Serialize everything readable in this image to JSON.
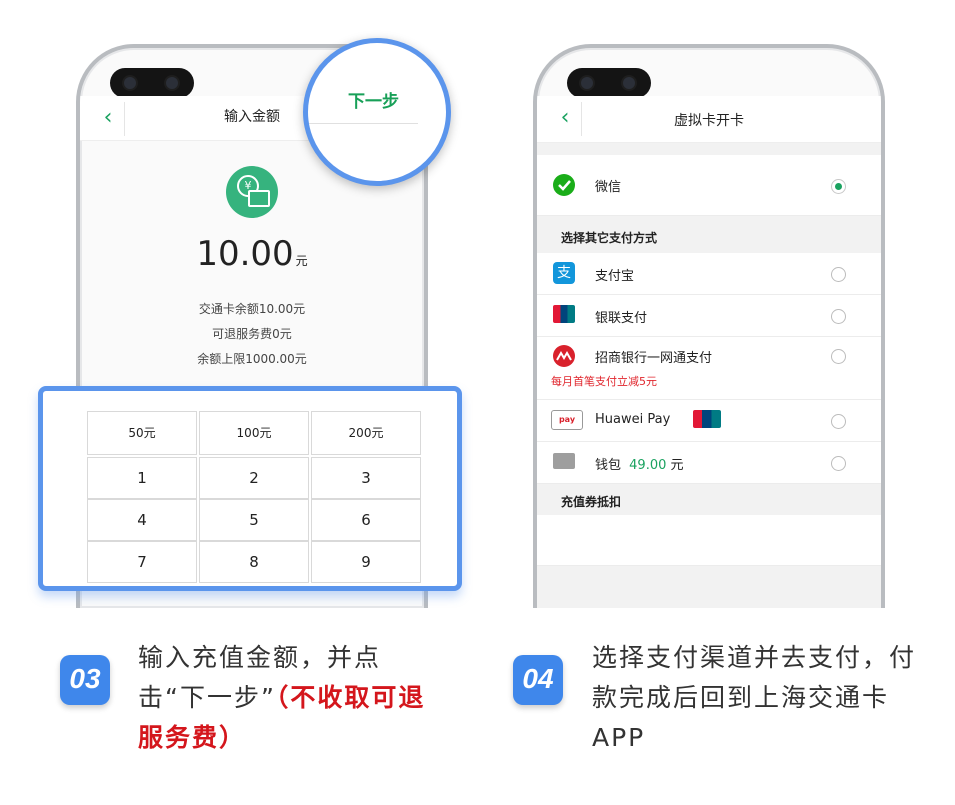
{
  "phone1": {
    "title": "输入金额",
    "back": "‹",
    "next": "下一步",
    "amount_value": "10.00",
    "amount_unit": "元",
    "info_lines": [
      "交通卡余额10.00元",
      "可退服务费0元",
      "余额上限1000.00元"
    ],
    "quick_amounts": [
      "50元",
      "100元",
      "200元"
    ],
    "keys": [
      "1",
      "2",
      "3",
      "4",
      "5",
      "6",
      "7",
      "8",
      "9"
    ]
  },
  "phone2": {
    "title": "虚拟卡开卡",
    "back": "‹",
    "wechat_label": "微信",
    "section_other": "选择其它支付方式",
    "methods": [
      {
        "label": "支付宝",
        "icon": "alipay-icon"
      },
      {
        "label": "银联支付",
        "icon": "unionpay-icon"
      },
      {
        "label": "招商银行一网通支付",
        "icon": "cmb-icon"
      }
    ],
    "promo": "每月首笔支付立减5元",
    "huawei_pay_label": "Huawei Pay",
    "wallet_label": "钱包",
    "wallet_amount": "49.00",
    "wallet_unit": "元",
    "section_coupon": "充值券抵扣"
  },
  "steps": [
    {
      "number": "03",
      "text_main": "输入充值金额，并点击“下一步”",
      "text_red": "（不收取可退服务费）"
    },
    {
      "number": "04",
      "text_main": "选择支付渠道并去支付，付款完成后回到上海交通卡APP"
    }
  ],
  "colors": {
    "accent_blue": "#5b95ec",
    "green": "#1aa260",
    "red": "#d4161c",
    "badge": "#3f87eb"
  }
}
